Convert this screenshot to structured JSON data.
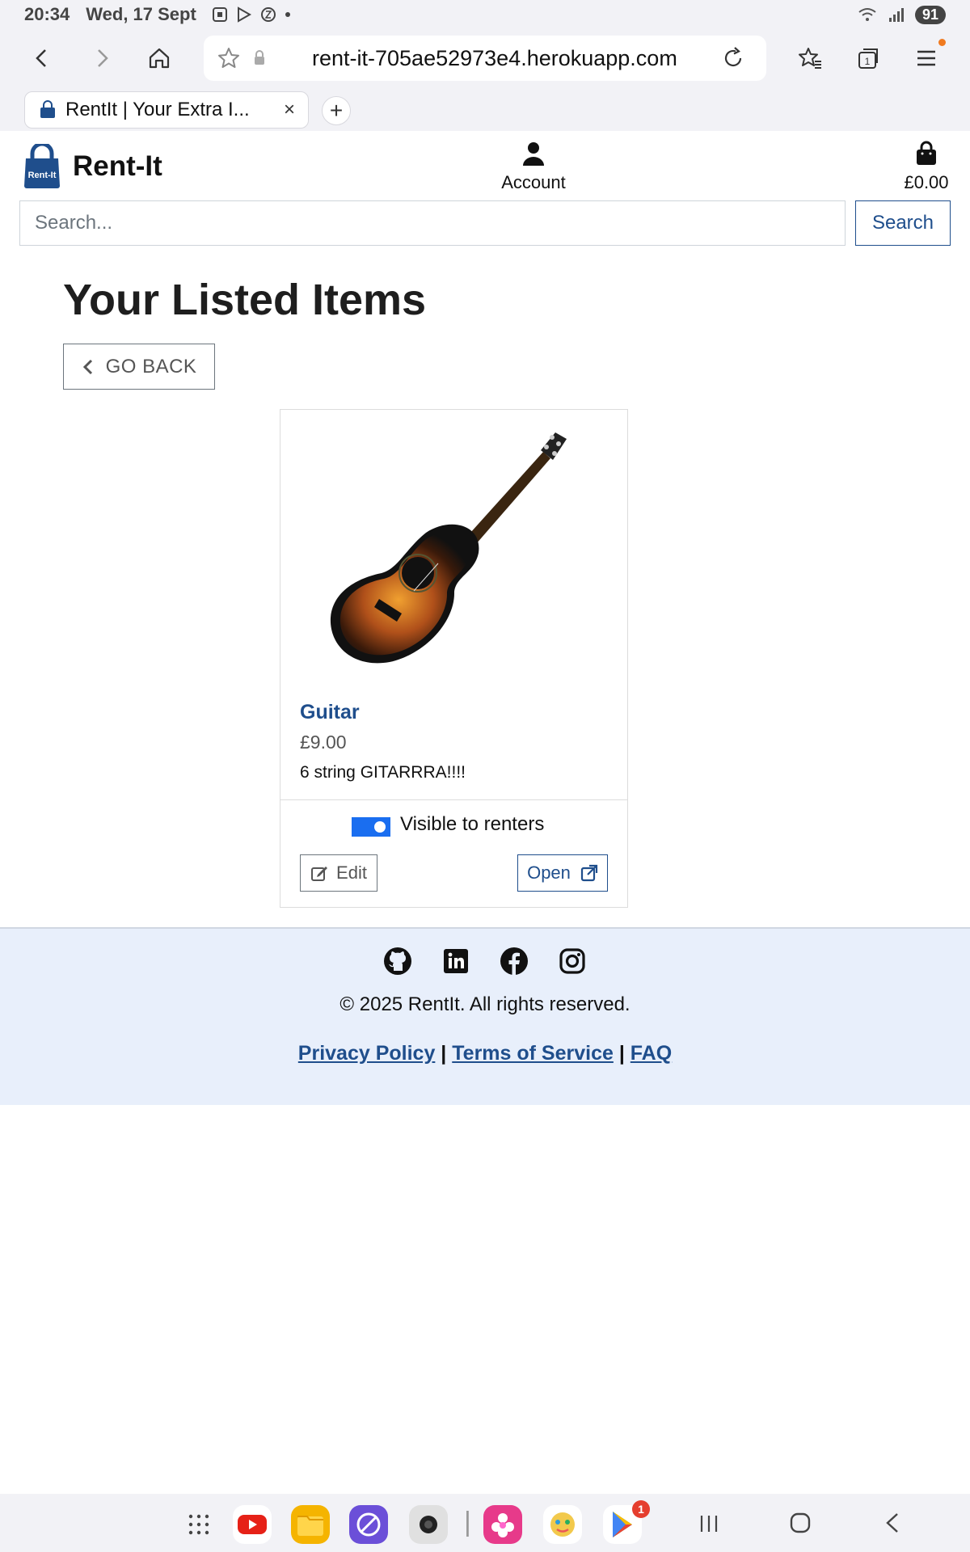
{
  "status": {
    "time": "20:34",
    "date": "Wed, 17 Sept",
    "battery": "91"
  },
  "browser": {
    "url": "rent-it-705ae52973e4.herokuapp.com",
    "tab_title": "RentIt | Your Extra I...",
    "tab_close": "×",
    "new_tab": "+",
    "tab_count": "1"
  },
  "header": {
    "logo_badge": "Rent-It",
    "brand": "Rent-It",
    "account_label": "Account",
    "cart_total": "£0.00",
    "search_placeholder": "Search...",
    "search_button": "Search"
  },
  "main": {
    "title": "Your Listed Items",
    "go_back": "GO BACK",
    "items": [
      {
        "title": "Guitar",
        "price": "£9.00",
        "description": "6 string GITARRRA!!!!",
        "visible_label": "Visible to renters",
        "visible": true,
        "edit_label": "Edit",
        "open_label": "Open"
      }
    ]
  },
  "footer": {
    "social_icons": [
      "github-icon",
      "linkedin-icon",
      "facebook-icon",
      "instagram-icon"
    ],
    "copyright": "© 2025 RentIt. All rights reserved.",
    "privacy": "Privacy Policy",
    "terms": "Terms of Service",
    "faq": "FAQ",
    "separator": " | "
  },
  "navbar": {
    "play_badge": "1"
  },
  "colors": {
    "brand_blue": "#1f4e8c",
    "toggle_blue": "#1a6ef0",
    "footer_bg": "#e8effb"
  }
}
